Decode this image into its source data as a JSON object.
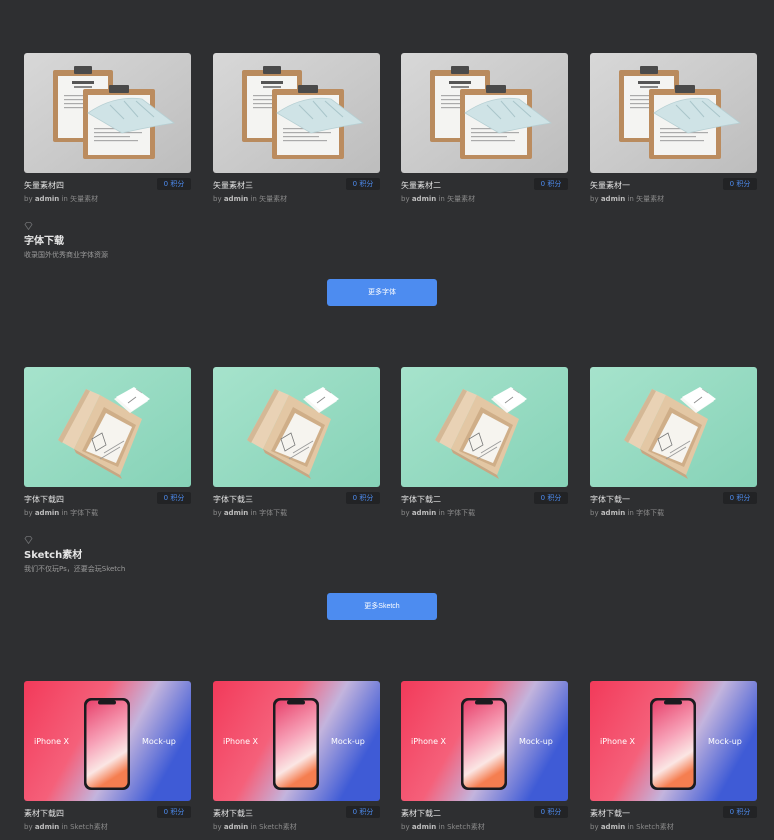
{
  "rows": [
    {
      "image": "clipboard-mockup",
      "cards": [
        {
          "title": "矢量素材四",
          "points": "0 积分",
          "by": "by",
          "author": "admin",
          "in": "in",
          "category": "矢量素材"
        },
        {
          "title": "矢量素材三",
          "points": "0 积分",
          "by": "by",
          "author": "admin",
          "in": "in",
          "category": "矢量素材"
        },
        {
          "title": "矢量素材二",
          "points": "0 积分",
          "by": "by",
          "author": "admin",
          "in": "in",
          "category": "矢量素材"
        },
        {
          "title": "矢量素材一",
          "points": "0 积分",
          "by": "by",
          "author": "admin",
          "in": "in",
          "category": "矢量素材"
        }
      ]
    },
    {
      "image": "business-card-mockup",
      "cards": [
        {
          "title": "字体下载四",
          "points": "0 积分",
          "by": "by",
          "author": "admin",
          "in": "in",
          "category": "字体下载"
        },
        {
          "title": "字体下载三",
          "points": "0 积分",
          "by": "by",
          "author": "admin",
          "in": "in",
          "category": "字体下载"
        },
        {
          "title": "字体下载二",
          "points": "0 积分",
          "by": "by",
          "author": "admin",
          "in": "in",
          "category": "字体下载"
        },
        {
          "title": "字体下载一",
          "points": "0 积分",
          "by": "by",
          "author": "admin",
          "in": "in",
          "category": "字体下载"
        }
      ]
    },
    {
      "image": "iphone-x-mockup",
      "image_text_left": "iPhone X",
      "image_text_right": "Mock-up",
      "cards": [
        {
          "title": "素材下载四",
          "points": "0 积分",
          "by": "by",
          "author": "admin",
          "in": "in",
          "category": "Sketch素材"
        },
        {
          "title": "素材下载三",
          "points": "0 积分",
          "by": "by",
          "author": "admin",
          "in": "in",
          "category": "Sketch素材"
        },
        {
          "title": "素材下载二",
          "points": "0 积分",
          "by": "by",
          "author": "admin",
          "in": "in",
          "category": "Sketch素材"
        },
        {
          "title": "素材下载一",
          "points": "0 积分",
          "by": "by",
          "author": "admin",
          "in": "in",
          "category": "Sketch素材"
        }
      ]
    }
  ],
  "sections": [
    {
      "icon": "diamond-icon",
      "title": "字体下载",
      "subtitle": "收录国外优秀商业字体资源",
      "button": "更多字体"
    },
    {
      "icon": "diamond-icon",
      "title": "Sketch素材",
      "subtitle": "我们不仅玩Ps，还要会玩Sketch",
      "button": "更多Sketch"
    }
  ],
  "colors": {
    "background": "#2e2f31",
    "accent": "#4d8cf0",
    "badge_bg": "#222325"
  }
}
